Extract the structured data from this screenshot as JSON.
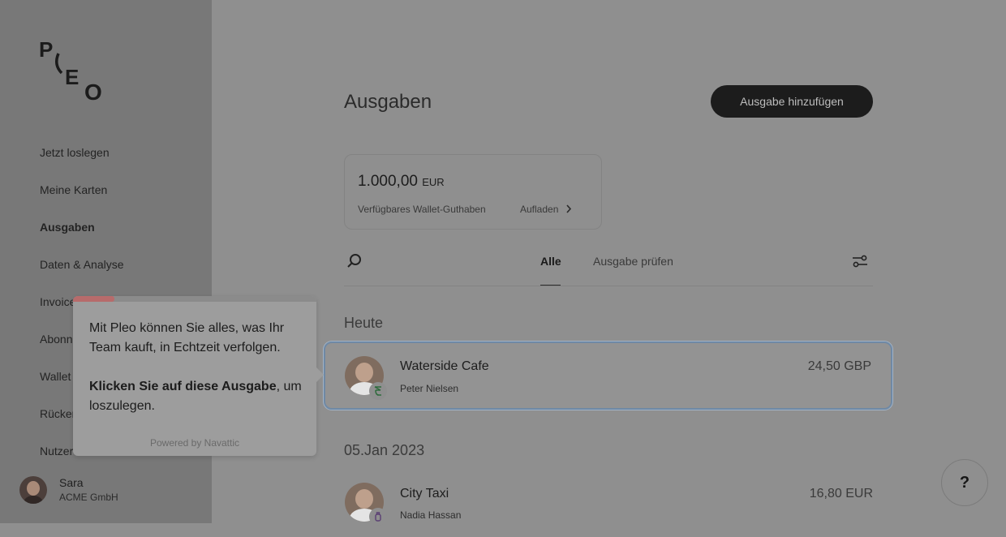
{
  "sidebar": {
    "logo_text": "PLEO",
    "items": [
      {
        "label": "Jetzt loslegen",
        "active": false
      },
      {
        "label": "Meine Karten",
        "active": false
      },
      {
        "label": "Ausgaben",
        "active": true
      },
      {
        "label": "Daten & Analyse",
        "active": false
      },
      {
        "label": "Invoices",
        "active": false
      },
      {
        "label": "Abonnements",
        "active": false
      },
      {
        "label": "Wallet",
        "active": false
      },
      {
        "label": "Rückerstattungen",
        "active": false
      },
      {
        "label": "Nutzer",
        "active": false
      }
    ],
    "user": {
      "name": "Sara",
      "org": "ACME GmbH"
    }
  },
  "header": {
    "title": "Ausgaben",
    "add_button": "Ausgabe hinzufügen"
  },
  "wallet": {
    "amount": "1.000,00",
    "currency": "EUR",
    "caption": "Verfügbares Wallet-Guthaben",
    "top_up": "Aufladen"
  },
  "tabs": {
    "all": "Alle",
    "review": "Ausgabe prüfen"
  },
  "sections": [
    {
      "label": "Heute",
      "expenses": [
        {
          "merchant": "Waterside Cafe",
          "person": "Peter Nielsen",
          "amount": "24,50 GBP",
          "category_icon": "food-icon"
        }
      ]
    },
    {
      "label": "05.Jan 2023",
      "expenses": [
        {
          "merchant": "City Taxi",
          "person": "Nadia Hassan",
          "amount": "16,80 EUR",
          "category_icon": "travel-icon"
        }
      ]
    }
  ],
  "tooltip": {
    "line1": "Mit Pleo können Sie alles, was Ihr Team kauft, in Echtzeit verfolgen.",
    "cta_bold": "Klicken Sie auf diese Ausgabe",
    "cta_rest": ", um loszulegen.",
    "footer": "Powered by Navattic",
    "progress_fraction": 0.17
  },
  "help": {
    "label": "?"
  },
  "colors": {
    "primary_button": "#1c1c1c",
    "highlight_border": "#6f89a5",
    "progress_accent": "#b76b6b"
  }
}
